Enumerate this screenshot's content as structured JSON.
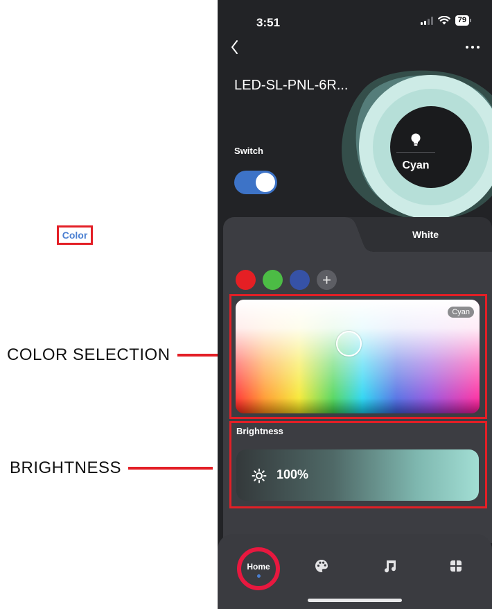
{
  "annotations": {
    "color_selection": "COLOR SELECTION",
    "brightness": "BRIGHTNESS",
    "highlight_color": "#e31f26"
  },
  "status_bar": {
    "time": "3:51",
    "battery": "79",
    "icons": [
      "signal-icon",
      "wifi-icon",
      "battery-icon"
    ]
  },
  "header": {
    "back_icon": "chevron-left-icon",
    "more_icon": "more-horizontal-icon",
    "device_name": "LED-SL-PNL-6R..."
  },
  "light_dial": {
    "icon": "lightbulb-icon",
    "current_color": "Cyan",
    "ring_color": "#cdebe6"
  },
  "switch": {
    "label": "Switch",
    "state": "on",
    "accent": "#3d73c7"
  },
  "tabs": [
    {
      "label": "Color",
      "active": true
    },
    {
      "label": "White",
      "active": false
    }
  ],
  "swatches": {
    "colors": [
      "#e51f24",
      "#4cbc45",
      "#3652a6"
    ],
    "add_icon": "plus-icon"
  },
  "color_picker": {
    "selected_label": "Cyan"
  },
  "brightness": {
    "label": "Brightness",
    "value": "100%",
    "icon": "sun-icon"
  },
  "bottom_nav": {
    "items": [
      {
        "label": "Home",
        "icon": "home-icon",
        "active": true
      },
      {
        "label": "",
        "icon": "palette-icon",
        "active": false
      },
      {
        "label": "",
        "icon": "music-icon",
        "active": false
      },
      {
        "label": "",
        "icon": "scenes-icon",
        "active": false
      }
    ]
  }
}
